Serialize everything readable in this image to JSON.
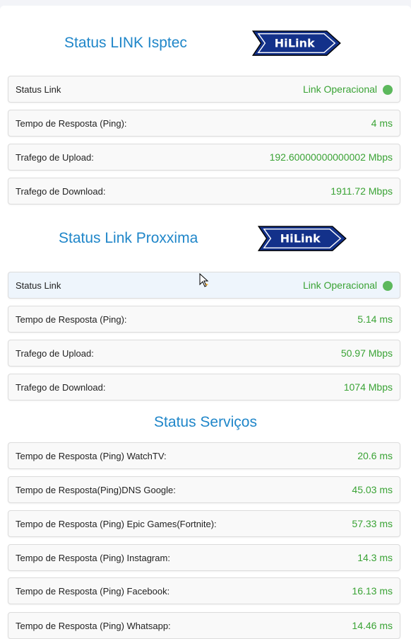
{
  "sections": [
    {
      "title": "Status LINK Isptec",
      "logo": "HiLink",
      "rows": [
        {
          "label": "Status Link",
          "value": "Link Operacional",
          "status": true
        },
        {
          "label": "Tempo de Resposta (Ping):",
          "value": "4 ms"
        },
        {
          "label": "Trafego de Upload:",
          "value": "192.60000000000002 Mbps"
        },
        {
          "label": "Trafego de Download:",
          "value": "1911.72 Mbps"
        }
      ]
    },
    {
      "title": "Status Link Proxxima",
      "logo": "HiLink",
      "rows": [
        {
          "label": "Status Link",
          "value": "Link Operacional",
          "status": true
        },
        {
          "label": "Tempo de Resposta (Ping):",
          "value": "5.14 ms"
        },
        {
          "label": "Trafego de Upload:",
          "value": "50.97 Mbps"
        },
        {
          "label": "Trafego de Download:",
          "value": "1074 Mbps"
        }
      ]
    }
  ],
  "services": {
    "title": "Status Serviços",
    "rows": [
      {
        "label": "Tempo de Resposta (Ping) WatchTV:",
        "value": "20.6 ms"
      },
      {
        "label": "Tempo de Resposta(Ping)DNS Google:",
        "value": "45.03 ms"
      },
      {
        "label": "Tempo de Resposta (Ping) Epic Games(Fortnite):",
        "value": "57.33 ms"
      },
      {
        "label": "Tempo de Resposta (Ping) Instagram:",
        "value": "14.3 ms"
      },
      {
        "label": "Tempo de Resposta (Ping) Facebook:",
        "value": "16.13 ms"
      },
      {
        "label": "Tempo de Resposta (Ping) Whatsapp:",
        "value": "14.46 ms"
      }
    ]
  },
  "colors": {
    "accent": "#1f86c9",
    "value_green": "#3aa335",
    "status_dot": "#5cb85c"
  }
}
